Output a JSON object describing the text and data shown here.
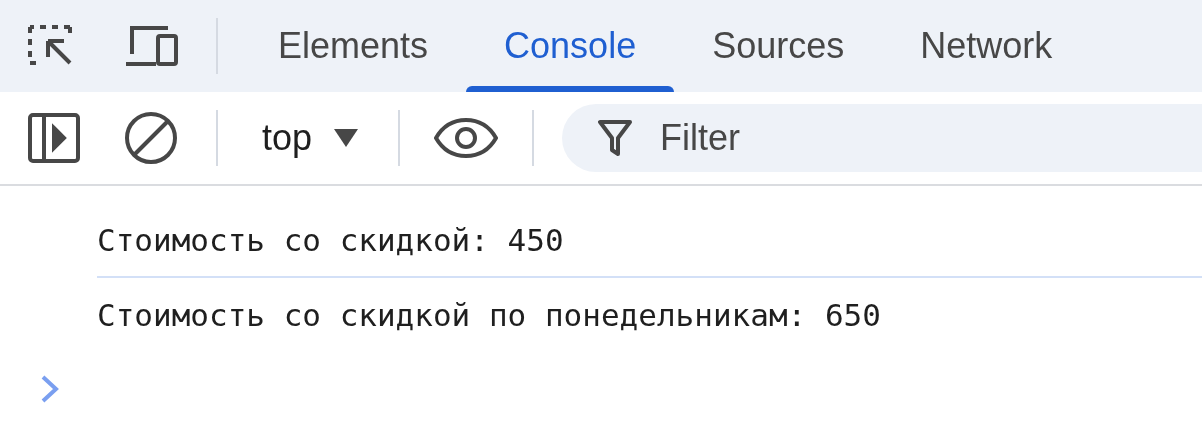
{
  "tabs": [
    {
      "label": "Elements",
      "selected": false
    },
    {
      "label": "Console",
      "selected": true
    },
    {
      "label": "Sources",
      "selected": false
    },
    {
      "label": "Network",
      "selected": false
    }
  ],
  "toolbar": {
    "context": "top",
    "filter": {
      "placeholder": "Filter"
    }
  },
  "messages": [
    "Стоимость со скидкой: 450",
    "Стоимость со скидкой по понедельникам: 650"
  ]
}
